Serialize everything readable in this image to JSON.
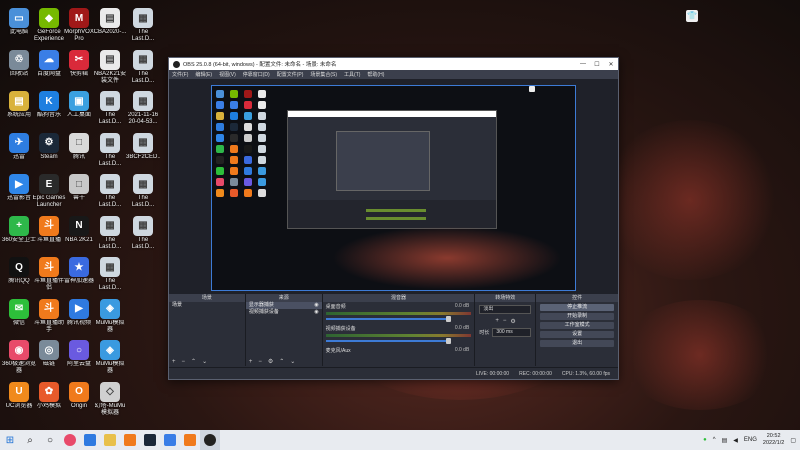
{
  "desktop": {
    "columns": [
      [
        {
          "label": "此电脑",
          "color": "#4a90d9",
          "glyph": "▭"
        },
        {
          "label": "回收站",
          "color": "#7a8a99",
          "glyph": "♲"
        },
        {
          "label": "系统应用",
          "color": "#d9b23b",
          "glyph": "▤"
        },
        {
          "label": "迅雷",
          "color": "#2e7de0",
          "glyph": "✈"
        },
        {
          "label": "迅雷影音",
          "color": "#2f86e8",
          "glyph": "▶"
        },
        {
          "label": "360安全卫士",
          "color": "#2eb84a",
          "glyph": "+"
        },
        {
          "label": "腾讯QQ",
          "color": "#111111",
          "glyph": "Q"
        },
        {
          "label": "微信",
          "color": "#2dbf3a",
          "glyph": "✉"
        },
        {
          "label": "360极速浏览器",
          "color": "#e84a6a",
          "glyph": "◉"
        },
        {
          "label": "UC浏览器",
          "color": "#f08a1c",
          "glyph": "U"
        }
      ],
      [
        {
          "label": "GeForce Experience",
          "color": "#76b900",
          "glyph": "◆"
        },
        {
          "label": "百度网盘",
          "color": "#3a7ee6",
          "glyph": "☁"
        },
        {
          "label": "酷狗音乐",
          "color": "#1e7fe0",
          "glyph": "K"
        },
        {
          "label": "Steam",
          "color": "#1b2838",
          "glyph": "⚙"
        },
        {
          "label": "Epic Games Launcher",
          "color": "#2a2a2a",
          "glyph": "E"
        },
        {
          "label": "斗鱼直播",
          "color": "#f07a1c",
          "glyph": "斗"
        },
        {
          "label": "斗鱼直播伴侣",
          "color": "#f07a1c",
          "glyph": "斗"
        },
        {
          "label": "斗鱼直播助手",
          "color": "#f07a1c",
          "glyph": "斗"
        },
        {
          "label": "磁链",
          "color": "#7a8a99",
          "glyph": "◎"
        },
        {
          "label": "小鸡模拟",
          "color": "#e85a2a",
          "glyph": "✿"
        }
      ],
      [
        {
          "label": "MorphVOX Pro",
          "color": "#a01818",
          "glyph": "M"
        },
        {
          "label": "快剪辑",
          "color": "#d92a3a",
          "glyph": "✂"
        },
        {
          "label": "人工桌面",
          "color": "#3aa0e0",
          "glyph": "▣"
        },
        {
          "label": "腾讯",
          "color": "#d9d9d9",
          "glyph": "□"
        },
        {
          "label": "兽千",
          "color": "#c8c8c8",
          "glyph": "□"
        },
        {
          "label": "NBA 2K21",
          "color": "#181818",
          "glyph": "N"
        },
        {
          "label": "雷神加速器",
          "color": "#3a6ae0",
          "glyph": "★"
        },
        {
          "label": "腾讯视频",
          "color": "#2f7ae0",
          "glyph": "▶"
        },
        {
          "label": "阿里云盘",
          "color": "#6a5ae0",
          "glyph": "○"
        },
        {
          "label": "Origin",
          "color": "#f07a1c",
          "glyph": "O"
        }
      ],
      [
        {
          "label": "CBA2020-...",
          "color": "#eaeaea",
          "glyph": "▤"
        },
        {
          "label": "NBA2K21安装文件",
          "color": "#eaeaea",
          "glyph": "▤"
        },
        {
          "label": "The Last.D...",
          "color": "#cfd8e0",
          "glyph": "▦"
        },
        {
          "label": "The Last.D...",
          "color": "#cfd8e0",
          "glyph": "▦"
        },
        {
          "label": "The Last.D...",
          "color": "#cfd8e0",
          "glyph": "▦"
        },
        {
          "label": "The Last.D...",
          "color": "#cfd8e0",
          "glyph": "▦"
        },
        {
          "label": "The Last.D...",
          "color": "#cfd8e0",
          "glyph": "▦"
        },
        {
          "label": "MuMu模拟器",
          "color": "#3a9ae0",
          "glyph": "◈"
        },
        {
          "label": "MuMu模拟器",
          "color": "#3a9ae0",
          "glyph": "◈"
        },
        {
          "label": "幻塔-MuMu模拟器",
          "color": "#d0d0d0",
          "glyph": "◇"
        }
      ],
      [
        {
          "label": "The Last.D...",
          "color": "#cfd8e0",
          "glyph": "▦"
        },
        {
          "label": "The Last.D...",
          "color": "#cfd8e0",
          "glyph": "▦"
        },
        {
          "label": "2021-11-16 20-04-53...",
          "color": "#cfd8e0",
          "glyph": "▦"
        },
        {
          "label": "3BCF2CED...",
          "color": "#cfd8e0",
          "glyph": "▦"
        },
        {
          "label": "The Last.D...",
          "color": "#cfd8e0",
          "glyph": "▦"
        },
        {
          "label": "The Last.D...",
          "color": "#cfd8e0",
          "glyph": "▦"
        }
      ]
    ]
  },
  "obs": {
    "title": "OBS 25.0.8 (64-bit, windows) - 配置文件: 未命名 - 场景: 未命名",
    "window_buttons": {
      "minimize": "—",
      "maximize": "☐",
      "close": "✕"
    },
    "menu": [
      "文件(F)",
      "编辑(E)",
      "视图(V)",
      "停靠窗口(D)",
      "配置文件(P)",
      "场景集合(S)",
      "工具(T)",
      "帮助(H)"
    ],
    "docks": {
      "scenes": {
        "title": "场景",
        "items": [
          "场景"
        ]
      },
      "sources": {
        "title": "来源",
        "items": [
          "显示器捕获",
          "视频捕获设备"
        ]
      },
      "mixer": {
        "title": "混音器",
        "channels": [
          {
            "name": "桌面音频",
            "db": "0.0 dB"
          },
          {
            "name": "视频捕获设备",
            "db": "0.0 dB"
          },
          {
            "name": "麦克风/Aux",
            "db": "0.0 dB"
          }
        ]
      },
      "transitions": {
        "title": "转场特效",
        "mode": "淡出",
        "duration_label": "时长",
        "duration": "300 ms"
      },
      "controls": {
        "title": "控件",
        "buttons": [
          "停止推流",
          "开始录制",
          "工作室模式",
          "设置",
          "退出"
        ]
      }
    },
    "status": {
      "live": "LIVE: 00:00:00",
      "rec": "REC: 00:00:00",
      "cpu": "CPU: 1.3%, 60.00 fps"
    }
  },
  "taskbar": {
    "start_icon": "windows-start",
    "lang": "ENG",
    "time": "20:52",
    "date": "2022/1/2"
  }
}
